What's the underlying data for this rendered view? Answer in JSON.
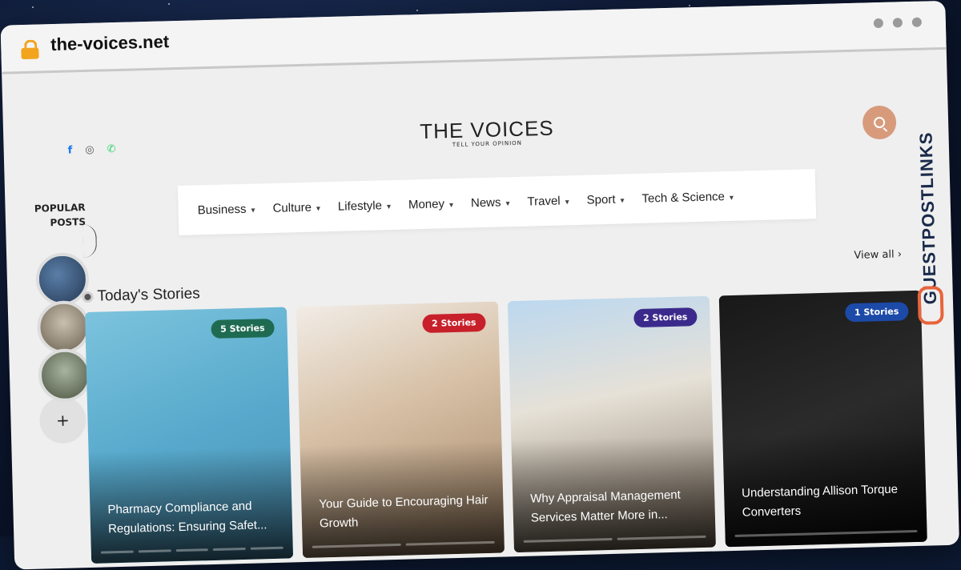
{
  "browser": {
    "url": "the-voices.net"
  },
  "social": {
    "icons": [
      "facebook-icon",
      "instagram-icon",
      "whatsapp-icon"
    ],
    "colors": [
      "#1877f2",
      "#555555",
      "#25d366"
    ]
  },
  "logo": {
    "main": "THE VOICES",
    "sub": "TELL YOUR OPINION"
  },
  "sidebar": {
    "popular_line1": "POPULAR",
    "popular_line2": "POSTS",
    "plus_label": "+"
  },
  "nav": {
    "items": [
      "Business",
      "Culture",
      "Lifestyle",
      "Money",
      "News",
      "Travel",
      "Sport",
      "Tech & Science"
    ]
  },
  "section": {
    "title": "Today's Stories",
    "view_all": "View all ›"
  },
  "cards": [
    {
      "badge": "5 Stories",
      "badge_color": "#1f6b52",
      "title": "Pharmacy Compliance and Regulations: Ensuring Safet..."
    },
    {
      "badge": "2 Stories",
      "badge_color": "#c8202a",
      "title": "Your Guide to Encouraging Hair Growth"
    },
    {
      "badge": "2 Stories",
      "badge_color": "#3b2a8c",
      "title": "Why Appraisal Management Services Matter More in..."
    },
    {
      "badge": "1 Stories",
      "badge_color": "#1c4aa8",
      "title": "Understanding Allison Torque Converters"
    }
  ],
  "watermark": {
    "text": "GUESTPOSTLINKS"
  }
}
